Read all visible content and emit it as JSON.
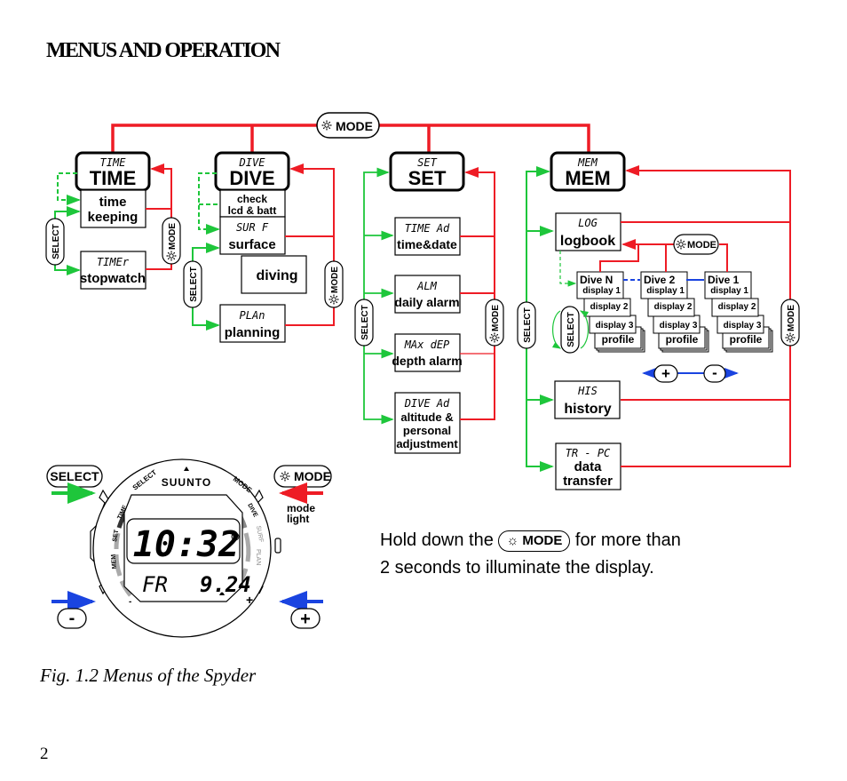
{
  "page": {
    "title": "MENUS AND OPERATION",
    "caption": "Fig. 1.2 Menus of the Spyder",
    "page_number": "2"
  },
  "colors": {
    "mode_line": "#ee1c25",
    "select_line": "#1ec63b",
    "plusminus_line": "#1a44e0",
    "box_border": "#000000"
  },
  "diagram": {
    "top_mode_button": {
      "icon": "light-icon",
      "label": "MODE"
    },
    "menus": [
      {
        "lcd": "TIME",
        "label": "TIME"
      },
      {
        "lcd": "DIVE",
        "label": "DIVE"
      },
      {
        "lcd": "SET",
        "label": "SET"
      },
      {
        "lcd": "MEM",
        "label": "MEM"
      }
    ],
    "time_submenus": [
      {
        "lcd": "",
        "label": "time keeping",
        "line1": "time",
        "line2": "keeping"
      },
      {
        "lcd": "TIMEr",
        "label": "stopwatch"
      }
    ],
    "dive_submenus": [
      {
        "line1": "check",
        "line2": "lcd & batt"
      },
      {
        "lcd": "SUR F",
        "label": "surface"
      },
      {
        "label": "diving"
      },
      {
        "lcd": "PLAn",
        "label": "planning"
      }
    ],
    "set_submenus": [
      {
        "lcd": "TIME Ad",
        "label": "time&date"
      },
      {
        "lcd": "ALM",
        "label": "daily alarm"
      },
      {
        "lcd": "MAx dEP",
        "label": "depth alarm"
      },
      {
        "lcd": "DIVE Ad",
        "line1": "altitude &",
        "line2": "personal",
        "line3": "adjustment"
      }
    ],
    "mem_submenus": [
      {
        "lcd": "LOG",
        "label": "logbook"
      },
      {
        "lcd": "HIS",
        "label": "history"
      },
      {
        "lcd": "TR - PC",
        "line1": "data",
        "line2": "transfer"
      }
    ],
    "logbook_dives": [
      {
        "name": "Dive N",
        "displays": [
          "display 1",
          "display 2",
          "display 3",
          "profile"
        ]
      },
      {
        "name": "Dive 2",
        "displays": [
          "display 1",
          "display 2",
          "display 3",
          "profile"
        ]
      },
      {
        "name": "Dive 1",
        "displays": [
          "display 1",
          "display 2",
          "display 3",
          "profile"
        ]
      }
    ],
    "select_label": "SELECT",
    "mode_label": "MODE",
    "plus_label": "+",
    "minus_label": "-"
  },
  "watch": {
    "brand": "SUUNTO",
    "select_button": "SELECT",
    "mode_button": "MODE",
    "mode_note_line1": "mode",
    "mode_note_line2": "light",
    "minus_button": "-",
    "plus_button": "+",
    "bezel_select": "SELECT",
    "bezel_mode": "MODE",
    "bezel_time": "TIME",
    "bezel_set": "SET",
    "bezel_mem": "MEM",
    "bezel_dive": "DIVE",
    "bezel_surf": "SURF",
    "bezel_plan": "PLAN",
    "display_time": "10:32",
    "display_day": "FR",
    "display_date": "9.24"
  },
  "hint": {
    "pre": "Hold down the",
    "button": "MODE",
    "post": "for more than",
    "line2": "2 seconds to illuminate the display."
  }
}
